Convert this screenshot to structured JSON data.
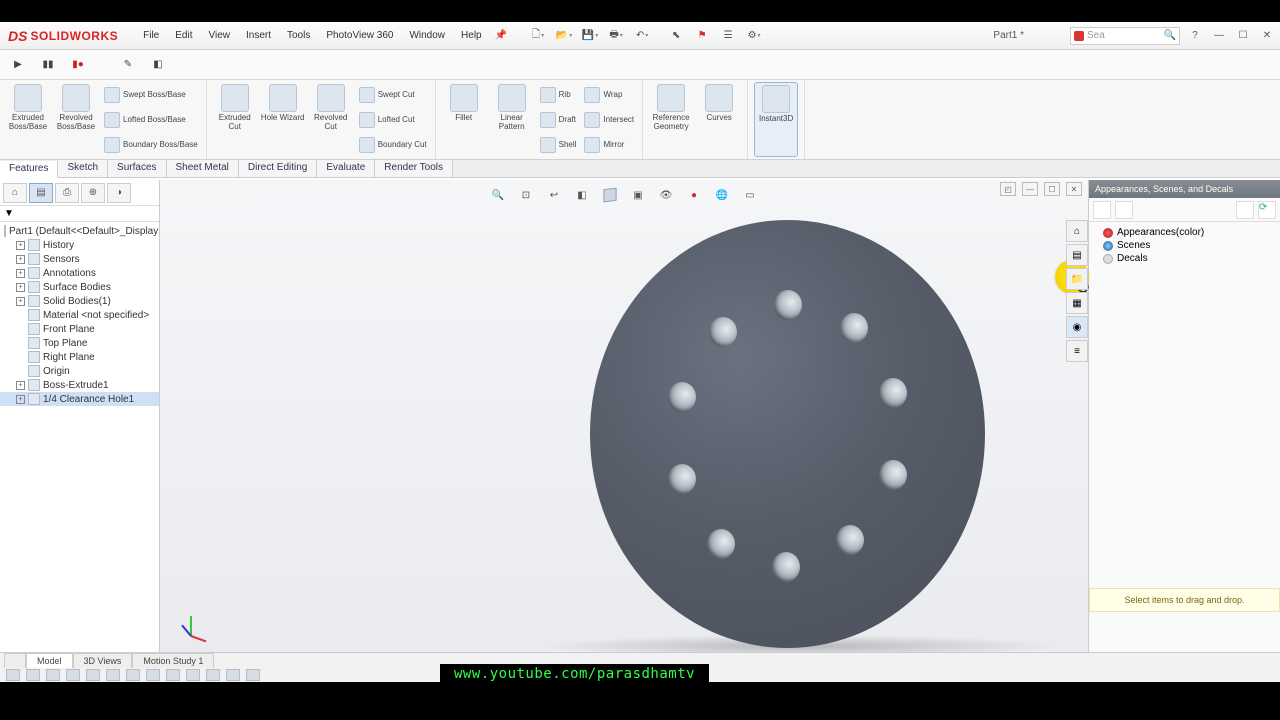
{
  "app": {
    "brand_ds": "DS",
    "brand_name": "SOLIDWORKS"
  },
  "menu": [
    "File",
    "Edit",
    "View",
    "Insert",
    "Tools",
    "PhotoView 360",
    "Window",
    "Help"
  ],
  "doc_name": "Part1 *",
  "search_placeholder": "Sea",
  "ribbon_tabs": [
    "Features",
    "Sketch",
    "Surfaces",
    "Sheet Metal",
    "Direct Editing",
    "Evaluate",
    "Render Tools"
  ],
  "ribbon": {
    "g1": {
      "extruded": "Extruded Boss/Base",
      "revolved": "Revolved Boss/Base",
      "swept": "Swept Boss/Base",
      "lofted": "Lofted Boss/Base",
      "boundary": "Boundary Boss/Base"
    },
    "g2": {
      "extcut": "Extruded Cut",
      "hole": "Hole Wizard",
      "revcut": "Revolved Cut",
      "sweptcut": "Swept Cut",
      "loftcut": "Lofted Cut",
      "boundcut": "Boundary Cut"
    },
    "g3": {
      "fillet": "Fillet",
      "pattern": "Linear Pattern",
      "rib": "Rib",
      "draft": "Draft",
      "shell": "Shell",
      "wrap": "Wrap",
      "intersect": "Intersect",
      "mirror": "Mirror"
    },
    "g4": {
      "refgeo": "Reference Geometry",
      "curves": "Curves"
    },
    "g5": {
      "instant3d": "Instant3D"
    }
  },
  "tree": {
    "root": "Part1 (Default<<Default>_Display State",
    "nodes": [
      "History",
      "Sensors",
      "Annotations",
      "Surface Bodies",
      "Solid Bodies(1)",
      "Material <not specified>",
      "Front Plane",
      "Top Plane",
      "Right Plane",
      "Origin",
      "Boss-Extrude1",
      "1/4 Clearance Hole1"
    ]
  },
  "right_panel": {
    "title": "Appearances, Scenes, and Decals",
    "nodes": [
      "Appearances(color)",
      "Scenes",
      "Decals"
    ],
    "hint": "Select items to drag and drop."
  },
  "bottom_tabs": [
    "",
    "Model",
    "3D Views",
    "Motion Study 1"
  ],
  "banner": "www.youtube.com/parasdhamtv"
}
